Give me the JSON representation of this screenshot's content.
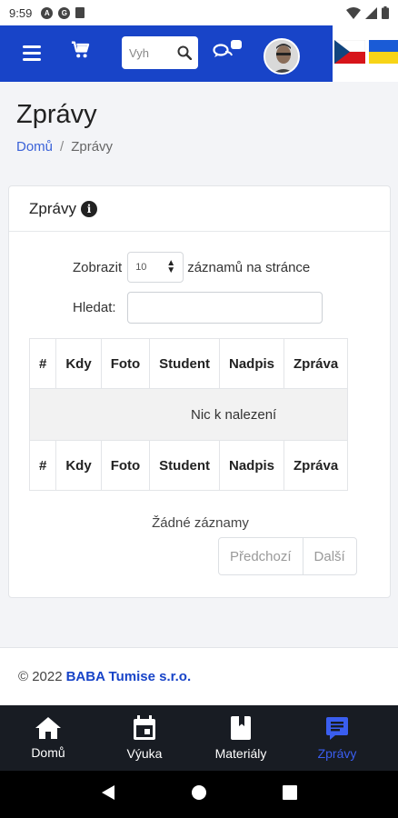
{
  "status_bar": {
    "time": "9:59"
  },
  "header": {
    "search_placeholder": "Vyh",
    "icons": [
      "menu-icon",
      "cart-icon",
      "search-icon",
      "chat-icon",
      "avatar"
    ],
    "accent_color": "#1844c8"
  },
  "languages": [
    {
      "name": "cz-flag-icon"
    },
    {
      "name": "ua-flag-icon"
    }
  ],
  "page": {
    "title": "Zprávy",
    "breadcrumb": {
      "home": "Domů",
      "separator": "/",
      "current": "Zprávy"
    }
  },
  "card": {
    "title": "Zprávy",
    "length_before": "Zobrazit",
    "length_value": "10",
    "length_after": "záznamů na stránce",
    "filter_label": "Hledat:",
    "filter_value": "",
    "columns": [
      "#",
      "Kdy",
      "Foto",
      "Student",
      "Nadpis",
      "Zpráva"
    ],
    "empty_text": "Nic k nalezení",
    "info_text": "Žádné záznamy",
    "prev_label": "Předchozí",
    "next_label": "Další"
  },
  "footer": {
    "copyright": "© 2022",
    "brand": "BABA Tumise s.r.o."
  },
  "tabbar": {
    "items": [
      {
        "label": "Domů",
        "icon": "home-icon",
        "active": false
      },
      {
        "label": "Výuka",
        "icon": "calendar-icon",
        "active": false
      },
      {
        "label": "Materiály",
        "icon": "book-icon",
        "active": false
      },
      {
        "label": "Zprávy",
        "icon": "message-icon",
        "active": true
      }
    ],
    "active_color": "#3a5ef0"
  }
}
